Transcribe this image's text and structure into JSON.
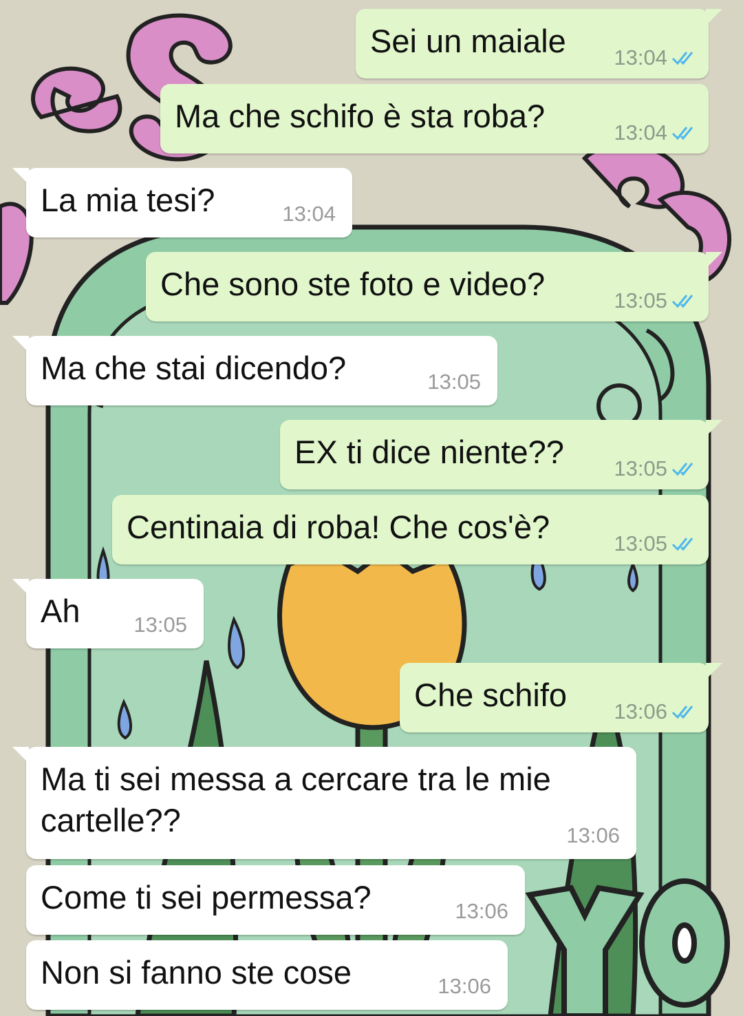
{
  "colors": {
    "outgoing_bubble": "#e1f7cb",
    "incoming_bubble": "#ffffff",
    "read_ticks": "#4fb6ec",
    "wallpaper_bg": "#d7d4c4"
  },
  "messages": [
    {
      "direction": "out",
      "text": "Sei un maiale",
      "time": "13:04",
      "status": "read-double-check-icon"
    },
    {
      "direction": "out",
      "text": "Ma che schifo è sta roba?",
      "time": "13:04",
      "status": "read-double-check-icon"
    },
    {
      "direction": "in",
      "text": "La mia tesi?",
      "time": "13:04"
    },
    {
      "direction": "out",
      "text": "Che sono ste foto e video?",
      "time": "13:05",
      "status": "read-double-check-icon"
    },
    {
      "direction": "in",
      "text": "Ma che stai dicendo?",
      "time": "13:05"
    },
    {
      "direction": "out",
      "text": "EX ti dice niente??",
      "time": "13:05",
      "status": "read-double-check-icon"
    },
    {
      "direction": "out",
      "text": "Centinaia di roba! Che cos'è?",
      "time": "13:05",
      "status": "read-double-check-icon"
    },
    {
      "direction": "in",
      "text": "Ah",
      "time": "13:05"
    },
    {
      "direction": "out",
      "text": "Che schifo",
      "time": "13:06",
      "status": "read-double-check-icon"
    },
    {
      "direction": "in",
      "text": "Ma ti sei messa a cercare tra le mie cartelle??",
      "time": "13:06"
    },
    {
      "direction": "in",
      "text": "Come ti sei permessa?",
      "time": "13:06"
    },
    {
      "direction": "in",
      "text": "Non si fanno ste cose",
      "time": "13:06"
    }
  ]
}
